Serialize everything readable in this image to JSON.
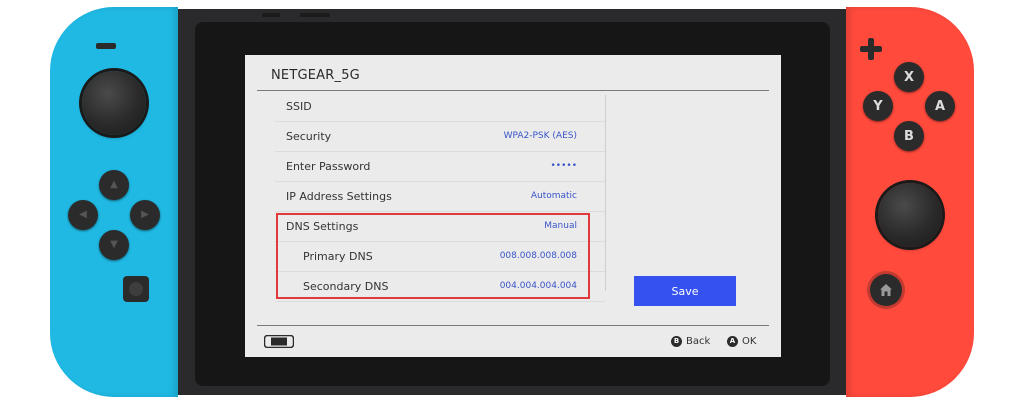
{
  "screen": {
    "network_name": "NETGEAR_5G",
    "settings": [
      {
        "label": "SSID",
        "value": ""
      },
      {
        "label": "Security",
        "value": "WPA2-PSK (AES)"
      },
      {
        "label": "Enter Password",
        "value": "•••••"
      },
      {
        "label": "IP Address Settings",
        "value": "Automatic"
      },
      {
        "label": "DNS Settings",
        "value": "Manual"
      },
      {
        "label": "Primary DNS",
        "value": "008.008.008.008"
      },
      {
        "label": "Secondary DNS",
        "value": "004.004.004.004"
      }
    ],
    "save_label": "Save",
    "footer": {
      "back_button": "B",
      "back_label": "Back",
      "ok_button": "A",
      "ok_label": "OK"
    }
  },
  "controllers": {
    "left_color": "#1fb9e3",
    "right_color": "#ff4a3c",
    "face_buttons": {
      "x": "X",
      "y": "Y",
      "a": "A",
      "b": "B"
    }
  },
  "highlight_color": "#e0393e",
  "accent_color": "#3551f0"
}
